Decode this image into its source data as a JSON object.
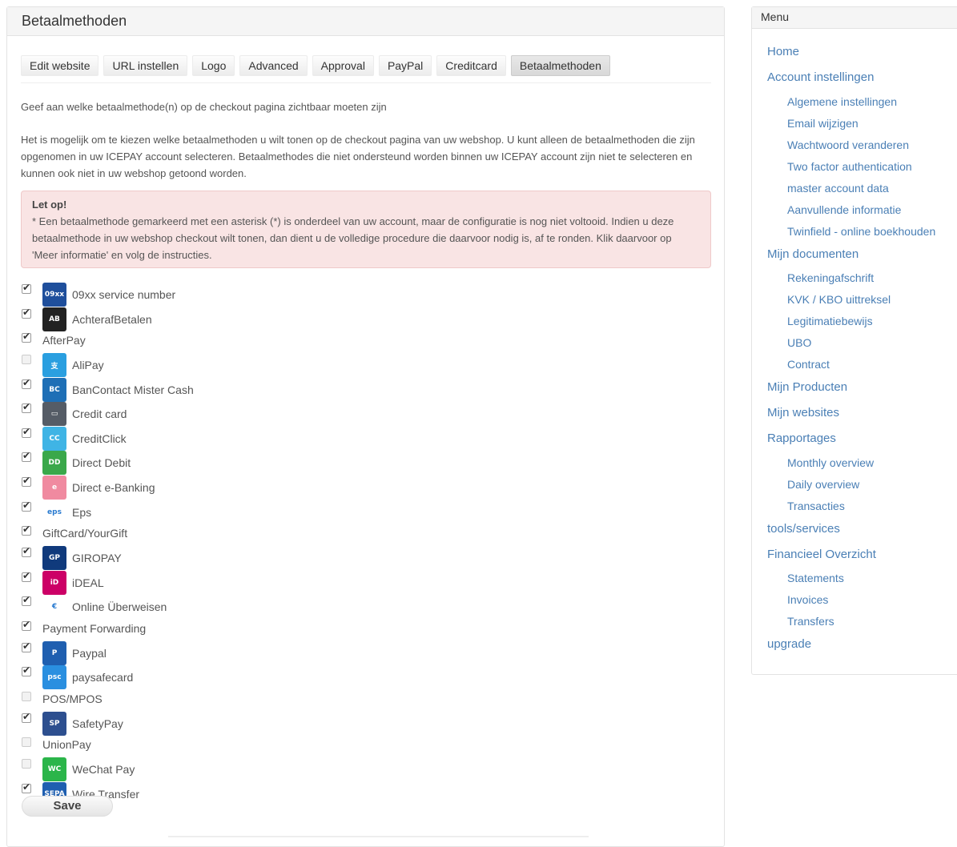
{
  "panel": {
    "title": "Betaalmethoden"
  },
  "tabs": [
    {
      "label": "Edit website",
      "active": false
    },
    {
      "label": "URL instellen",
      "active": false
    },
    {
      "label": "Logo",
      "active": false
    },
    {
      "label": "Advanced",
      "active": false
    },
    {
      "label": "Approval",
      "active": false
    },
    {
      "label": "PayPal",
      "active": false
    },
    {
      "label": "Creditcard",
      "active": false
    },
    {
      "label": "Betaalmethoden",
      "active": true
    }
  ],
  "intro": "Geef aan welke betaalmethode(n) op de checkout pagina zichtbaar moeten zijn",
  "description": "Het is mogelijk om te kiezen welke betaalmethoden u wilt tonen op de checkout pagina van uw webshop. U kunt alleen de betaalmethoden die zijn opgenomen in uw ICEPAY account selecteren. Betaalmethodes die niet ondersteund worden binnen uw ICEPAY account zijn niet te selecteren en kunnen ook niet in uw webshop getoond worden.",
  "alert": {
    "title": "Let op!",
    "text": "* Een betaalmethode gemarkeerd met een asterisk (*) is onderdeel van uw account, maar de configuratie is nog niet voltooid. Indien u deze betaalmethode in uw webshop checkout wilt tonen, dan dient u de volledige procedure die daarvoor nodig is, af te ronden. Klik daarvoor op 'Meer informatie' en volg de instructies."
  },
  "methods": [
    {
      "label": "09xx service number",
      "checked": true,
      "icon": "service-number-icon",
      "color": "#1f4f9c",
      "glyph": "09xx"
    },
    {
      "label": "AchterafBetalen",
      "checked": true,
      "icon": "achterafbetalen-icon",
      "color": "#222222",
      "glyph": "AB"
    },
    {
      "label": "AfterPay",
      "checked": true,
      "icon": null
    },
    {
      "label": "AliPay",
      "checked": false,
      "icon": "alipay-icon",
      "color": "#2a9fe0",
      "glyph": "支"
    },
    {
      "label": "BanContact Mister Cash",
      "checked": true,
      "icon": "bancontact-icon",
      "color": "#1e6fb6",
      "glyph": "BC"
    },
    {
      "label": "Credit card",
      "checked": true,
      "icon": "credit-card-icon",
      "color": "#555c66",
      "glyph": "▭"
    },
    {
      "label": "CreditClick",
      "checked": true,
      "icon": "creditclick-icon",
      "color": "#3fb4e5",
      "glyph": "CC"
    },
    {
      "label": "Direct Debit",
      "checked": true,
      "icon": "direct-debit-icon",
      "color": "#3aa84a",
      "glyph": "DD"
    },
    {
      "label": "Direct e-Banking",
      "checked": true,
      "icon": "direct-ebanking-icon",
      "color": "#f08aa0",
      "glyph": "e"
    },
    {
      "label": "Eps",
      "checked": true,
      "icon": "eps-icon",
      "color": "#ffffff",
      "glyph": "eps"
    },
    {
      "label": "GiftCard/YourGift",
      "checked": true,
      "icon": null
    },
    {
      "label": "GIROPAY",
      "checked": true,
      "icon": "giropay-icon",
      "color": "#103a7c",
      "glyph": "GP"
    },
    {
      "label": "iDEAL",
      "checked": true,
      "icon": "ideal-icon",
      "color": "#cc0066",
      "glyph": "iD"
    },
    {
      "label": "Online Überweisen",
      "checked": true,
      "icon": "online-ueberweisen-icon",
      "color": "#ffffff",
      "glyph": "€"
    },
    {
      "label": "Payment Forwarding",
      "checked": true,
      "icon": null
    },
    {
      "label": "Paypal",
      "checked": true,
      "icon": "paypal-icon",
      "color": "#1f5fb0",
      "glyph": "P"
    },
    {
      "label": "paysafecard",
      "checked": true,
      "icon": "paysafecard-icon",
      "color": "#2a8fe0",
      "glyph": "psc"
    },
    {
      "label": "POS/MPOS",
      "checked": false,
      "icon": null
    },
    {
      "label": "SafetyPay",
      "checked": true,
      "icon": "safetypay-icon",
      "color": "#2d4f8f",
      "glyph": "SP"
    },
    {
      "label": "UnionPay",
      "checked": false,
      "icon": null
    },
    {
      "label": "WeChat Pay",
      "checked": false,
      "icon": "wechat-pay-icon",
      "color": "#2bb54a",
      "glyph": "WC"
    },
    {
      "label": "Wire Transfer",
      "checked": true,
      "icon": "wire-transfer-icon",
      "color": "#1f5fb0",
      "glyph": "SEPA"
    }
  ],
  "save_label": "Save",
  "sidebar": {
    "title": "Menu",
    "items": [
      {
        "label": "Home",
        "sub": []
      },
      {
        "label": "Account instellingen",
        "sub": [
          "Algemene instellingen",
          "Email wijzigen",
          "Wachtwoord veranderen",
          "Two factor authentication",
          "master account data",
          "Aanvullende informatie",
          "Twinfield - online boekhouden"
        ]
      },
      {
        "label": "Mijn documenten",
        "sub": [
          "Rekeningafschrift",
          "KVK / KBO uittreksel",
          "Legitimatiebewijs",
          "UBO",
          "Contract"
        ]
      },
      {
        "label": "Mijn Producten",
        "sub": []
      },
      {
        "label": "Mijn websites",
        "sub": []
      },
      {
        "label": "Rapportages",
        "sub": [
          "Monthly overview",
          "Daily overview",
          "Transacties"
        ]
      },
      {
        "label": "tools/services",
        "sub": []
      },
      {
        "label": "Financieel Overzicht",
        "sub": [
          "Statements",
          "Invoices",
          "Transfers"
        ]
      },
      {
        "label": "upgrade",
        "sub": []
      }
    ]
  }
}
